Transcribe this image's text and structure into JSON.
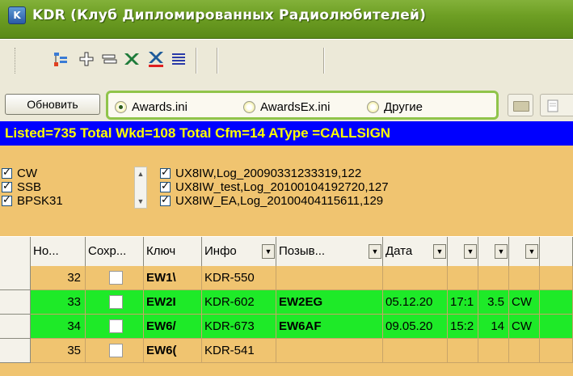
{
  "window": {
    "title": "KDR (Клуб Дипломированных Радиолюбителей)",
    "icon_label": "K"
  },
  "toolbar": {
    "icons": [
      "tree-add-icon",
      "add-icon",
      "list-icon",
      "excel-export-icon",
      "excel-export-red-icon",
      "lines-icon"
    ]
  },
  "actions": {
    "refresh_label": "Обновить"
  },
  "file_options": [
    {
      "label": "Awards.ini",
      "selected": true
    },
    {
      "label": "AwardsEx.ini",
      "selected": false
    },
    {
      "label": "Другие",
      "selected": false
    }
  ],
  "status_line": "Listed=735  Total Wkd=108  Total Cfm=14  AType =CALLSIGN",
  "modes": [
    "CW",
    "SSB",
    "BPSK31"
  ],
  "logs": [
    "UX8IW,Log_20090331233319,122",
    "UX8IW_test,Log_20100104192720,127",
    "UX8IW_EA,Log_20100404115611,129"
  ],
  "table": {
    "headers": [
      "Но...",
      "Сохр...",
      "Ключ",
      "Инфо",
      "Позыв...",
      "Дата",
      "",
      "",
      ""
    ],
    "rows": [
      {
        "num": "32",
        "key": "EW1\\",
        "info": "KDR-550",
        "call": "",
        "date": "",
        "time": "",
        "band": "",
        "mode": "",
        "green": false
      },
      {
        "num": "33",
        "key": "EW2I",
        "info": "KDR-602",
        "call": "EW2EG",
        "date": "05.12.20",
        "time": "17:1",
        "band": "3.5",
        "mode": "CW",
        "green": true
      },
      {
        "num": "34",
        "key": "EW6/",
        "info": "KDR-673",
        "call": "EW6AF",
        "date": "09.05.20",
        "time": "15:2",
        "band": "14",
        "mode": "CW",
        "green": true
      },
      {
        "num": "35",
        "key": "EW6(",
        "info": "KDR-541",
        "call": "",
        "date": "",
        "time": "",
        "band": "",
        "mode": "",
        "green": false
      }
    ]
  },
  "colors": {
    "title_bar": "#6e9f24",
    "status_bg": "#0000ff",
    "status_text": "#ffff00",
    "filter_bg": "#f0c470",
    "row_highlight": "#1eea28"
  }
}
